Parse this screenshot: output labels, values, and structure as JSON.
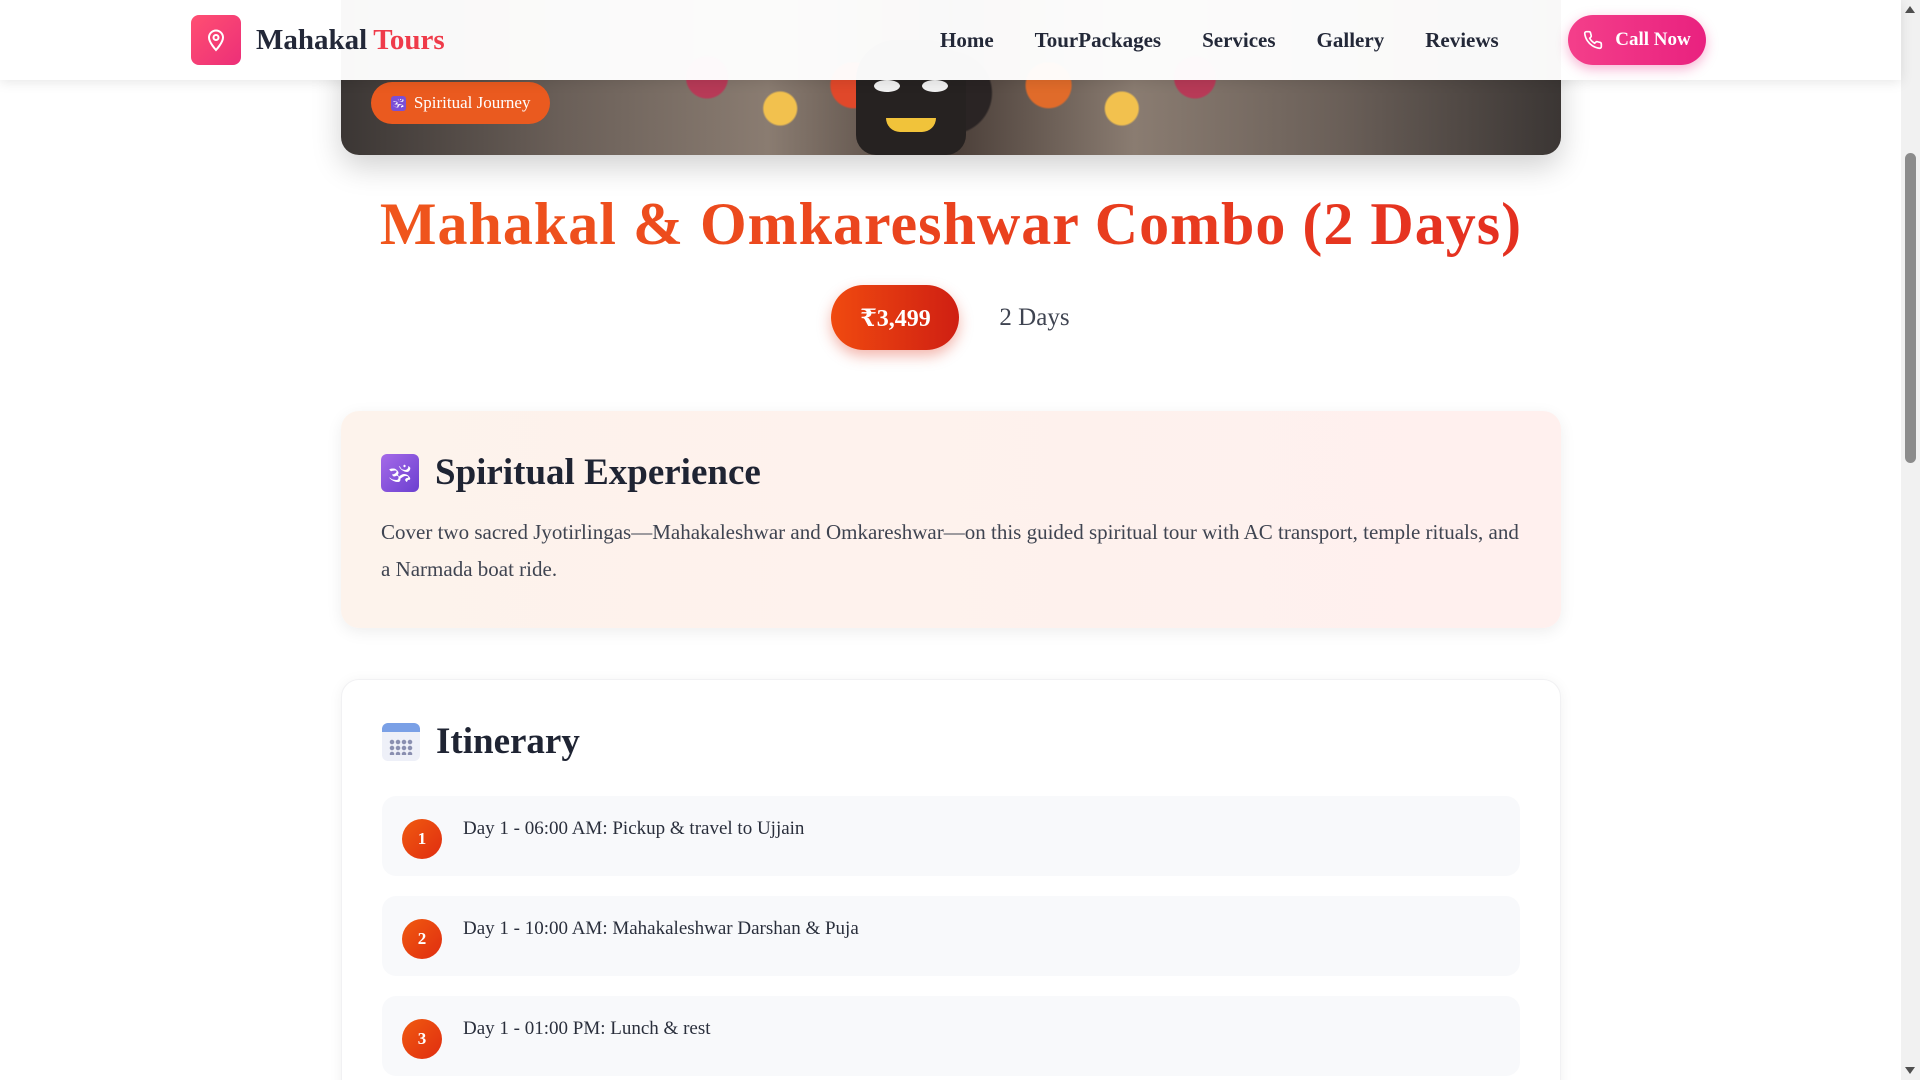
{
  "header": {
    "brand_name": "Mahakal",
    "brand_accent": "Tours",
    "nav": [
      "Home",
      "TourPackages",
      "Services",
      "Gallery",
      "Reviews"
    ],
    "call_label": "Call Now"
  },
  "hero": {
    "badge_icon": "🕉",
    "badge_label": "Spiritual Journey"
  },
  "tour": {
    "title": "Mahakal & Omkareshwar Combo (2 Days)",
    "price": "₹3,499",
    "duration": "2 Days"
  },
  "experience": {
    "icon": "🕉",
    "title": "Spiritual Experience",
    "text": "Cover two sacred Jyotirlingas—Mahakaleshwar and Omkareshwar—on this guided spiritual tour with AC transport, temple rituals, and a Narmada boat ride."
  },
  "itinerary": {
    "title": "Itinerary",
    "items": [
      {
        "num": "1",
        "text": "Day 1 - 06:00 AM: Pickup & travel to Ujjain"
      },
      {
        "num": "2",
        "text": "Day 1 - 10:00 AM: Mahakaleshwar Darshan & Puja"
      },
      {
        "num": "3",
        "text": "Day 1 - 01:00 PM: Lunch & rest"
      }
    ]
  },
  "colors": {
    "accent_orange": "#f04a10",
    "brand_pink": "#ec2f78",
    "brand_red": "#ef3b4a"
  }
}
